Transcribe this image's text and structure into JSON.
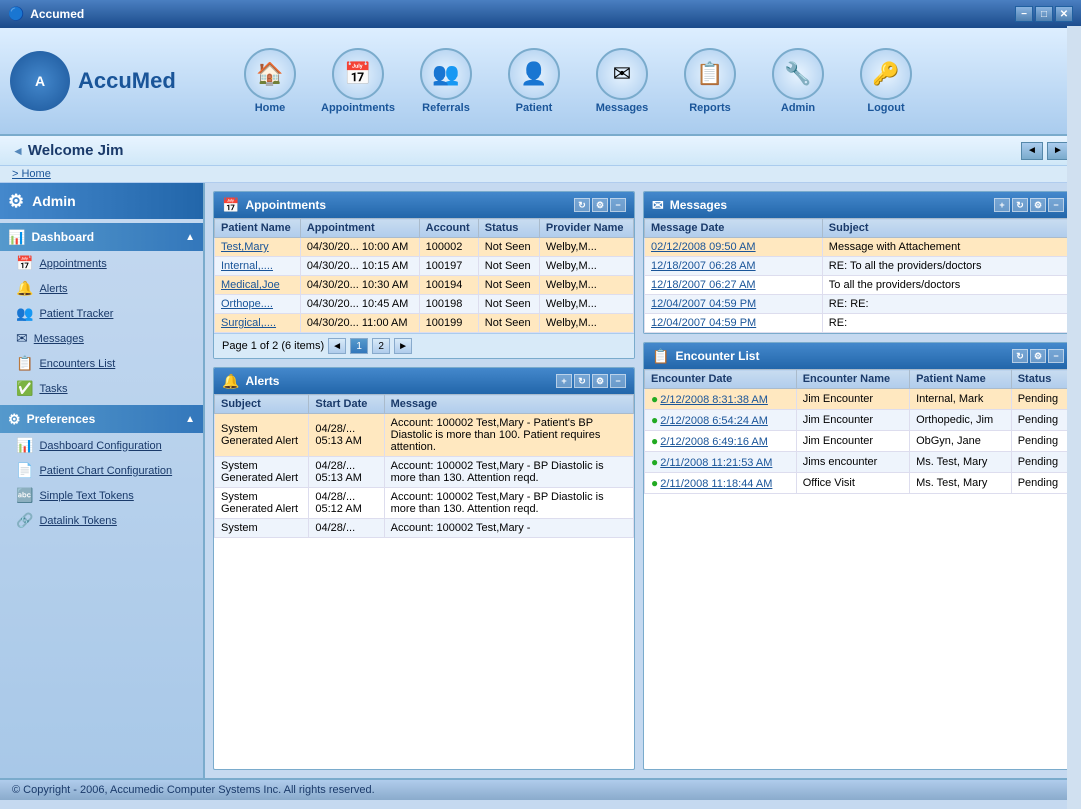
{
  "app": {
    "title": "Accumed",
    "copyright": "© Copyright - 2006, Accumedic Computer Systems Inc. All rights reserved."
  },
  "titlebar": {
    "title": "Accumed",
    "minimize": "−",
    "maximize": "□",
    "close": "✕"
  },
  "nav": {
    "items": [
      {
        "label": "Home",
        "icon": "🏠"
      },
      {
        "label": "Appointments",
        "icon": "📅"
      },
      {
        "label": "Referrals",
        "icon": "👥"
      },
      {
        "label": "Patient",
        "icon": "👤"
      },
      {
        "label": "Messages",
        "icon": "✉"
      },
      {
        "label": "Reports",
        "icon": "📋"
      },
      {
        "label": "Admin",
        "icon": "🔧"
      },
      {
        "label": "Logout",
        "icon": "🔑"
      }
    ]
  },
  "welcome": {
    "title": "Welcome Jim",
    "breadcrumb": "> Home"
  },
  "sidebar": {
    "title": "Admin",
    "sections": [
      {
        "label": "Dashboard",
        "items": [
          {
            "label": "Appointments"
          },
          {
            "label": "Alerts"
          },
          {
            "label": "Patient Tracker"
          },
          {
            "label": "Messages"
          },
          {
            "label": "Encounters List"
          },
          {
            "label": "Tasks"
          }
        ]
      },
      {
        "label": "Preferences",
        "items": [
          {
            "label": "Dashboard Configuration"
          },
          {
            "label": "Patient Chart Configuration"
          },
          {
            "label": "Simple Text Tokens"
          },
          {
            "label": "Datalink Tokens"
          }
        ]
      }
    ]
  },
  "appointments": {
    "title": "Appointments",
    "columns": [
      "Patient Name",
      "Appointment",
      "Account",
      "Status",
      "Provider Name"
    ],
    "rows": [
      {
        "patient": "Test,Mary",
        "appointment": "04/30/20... 10:00 AM",
        "account": "100002",
        "status": "Not Seen",
        "provider": "Welby,M...",
        "highlight": true
      },
      {
        "patient": "Internal,....",
        "appointment": "04/30/20... 10:15 AM",
        "account": "100197",
        "status": "Not Seen",
        "provider": "Welby,M...",
        "highlight": false
      },
      {
        "patient": "Medical,Joe",
        "appointment": "04/30/20... 10:30 AM",
        "account": "100194",
        "status": "Not Seen",
        "provider": "Welby,M...",
        "highlight": true
      },
      {
        "patient": "Orthope....",
        "appointment": "04/30/20... 10:45 AM",
        "account": "100198",
        "status": "Not Seen",
        "provider": "Welby,M...",
        "highlight": false
      },
      {
        "patient": "Surgical,....",
        "appointment": "04/30/20... 11:00 AM",
        "account": "100199",
        "status": "Not Seen",
        "provider": "Welby,M...",
        "highlight": true
      }
    ],
    "pagination": "Page 1 of 2 (6 items)",
    "pages": [
      "1",
      "2"
    ]
  },
  "alerts": {
    "title": "Alerts",
    "columns": [
      "Subject",
      "Start Date",
      "Message"
    ],
    "rows": [
      {
        "subject": "System Generated Alert",
        "start_date": "04/28/... 05:13 AM",
        "message": "Account: 100002 Test,Mary - Patient's BP Diastolic is more than 100. Patient requires attention.",
        "highlight": true
      },
      {
        "subject": "System Generated Alert",
        "start_date": "04/28/... 05:13 AM",
        "message": "Account: 100002 Test,Mary - BP Diastolic is more than 130. Attention reqd.",
        "highlight": false
      },
      {
        "subject": "System Generated Alert",
        "start_date": "04/28/... 05:12 AM",
        "message": "Account: 100002 Test,Mary - BP Diastolic is more than 130. Attention reqd.",
        "highlight": false
      },
      {
        "subject": "System",
        "start_date": "04/28/...",
        "message": "Account: 100002 Test,Mary -",
        "highlight": false
      }
    ]
  },
  "messages": {
    "title": "Messages",
    "columns": [
      "Message Date",
      "Subject"
    ],
    "rows": [
      {
        "date": "02/12/2008 09:50 AM",
        "subject": "Message with Attachement",
        "highlight": true
      },
      {
        "date": "12/18/2007 06:28 AM",
        "subject": "RE: To all the providers/doctors",
        "highlight": false
      },
      {
        "date": "12/18/2007 06:27 AM",
        "subject": "To all the providers/doctors",
        "highlight": false
      },
      {
        "date": "12/04/2007 04:59 PM",
        "subject": "RE: RE:",
        "highlight": false
      },
      {
        "date": "12/04/2007 04:59 PM",
        "subject": "RE:",
        "highlight": false
      }
    ]
  },
  "encounters": {
    "title": "Encounter List",
    "columns": [
      "Encounter Date",
      "Encounter Name",
      "Patient Name",
      "Status"
    ],
    "rows": [
      {
        "date": "2/12/2008 8:31:38 AM",
        "name": "Jim Encounter",
        "patient": "Internal, Mark",
        "status": "Pending",
        "highlight": true
      },
      {
        "date": "2/12/2008 6:54:24 AM",
        "name": "Jim Encounter",
        "patient": "Orthopedic, Jim",
        "status": "Pending",
        "highlight": false
      },
      {
        "date": "2/12/2008 6:49:16 AM",
        "name": "Jim Encounter",
        "patient": "ObGyn, Jane",
        "status": "Pending",
        "highlight": false
      },
      {
        "date": "2/11/2008 11:21:53 AM",
        "name": "Jims encounter",
        "patient": "Ms. Test, Mary",
        "status": "Pending",
        "highlight": false
      },
      {
        "date": "2/11/2008 11:18:44 AM",
        "name": "Office Visit",
        "patient": "Ms. Test, Mary",
        "status": "Pending",
        "highlight": false
      }
    ]
  }
}
